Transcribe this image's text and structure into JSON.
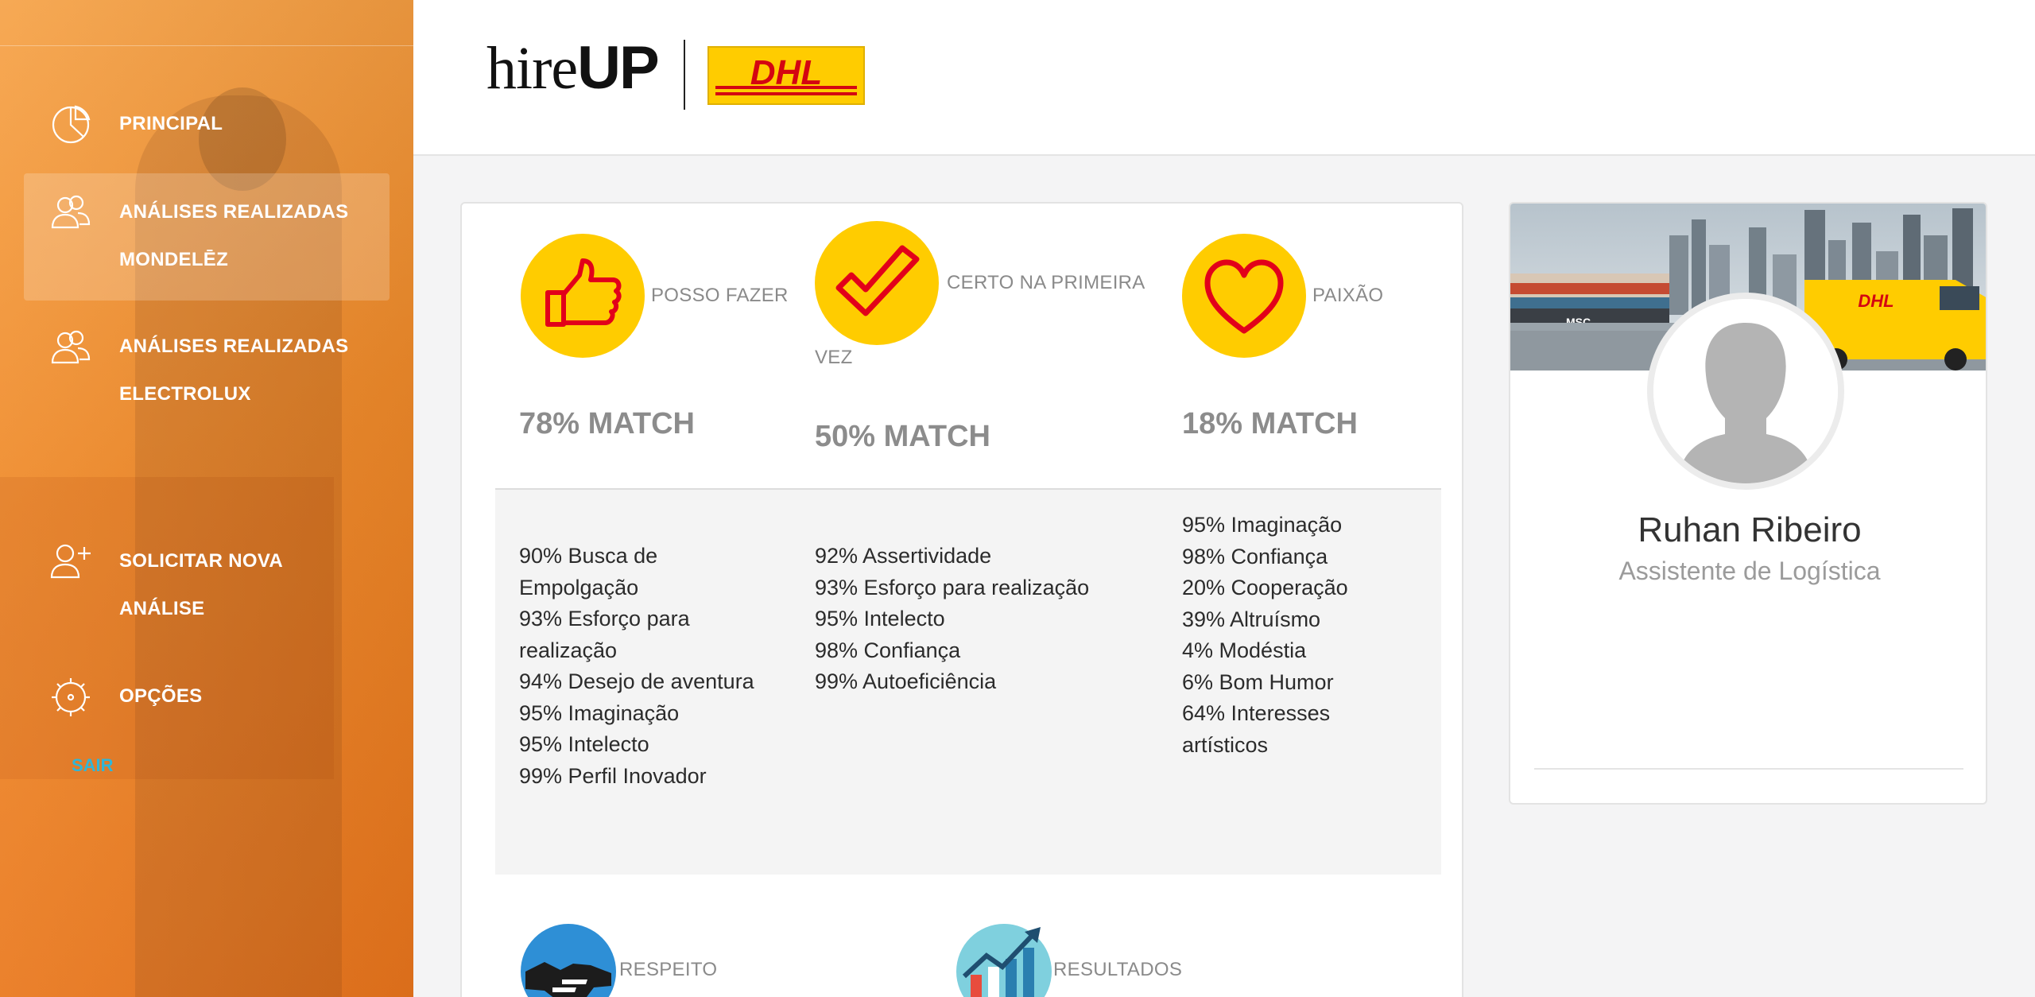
{
  "brand": {
    "logo_hire": "hire",
    "logo_up": "UP",
    "partner": "DHL"
  },
  "sidebar": {
    "items": [
      {
        "icon": "pie-chart-icon",
        "lines": [
          "PRINCIPAL"
        ]
      },
      {
        "icon": "users-icon",
        "lines": [
          "ANÁLISES REALIZADAS",
          "MONDELĒZ"
        ],
        "active": true
      },
      {
        "icon": "users-icon",
        "lines": [
          "ANÁLISES REALIZADAS",
          "ELECTROLUX"
        ]
      },
      {
        "icon": "add-user-icon",
        "lines": [
          "SOLICITAR NOVA",
          "ANÁLISE"
        ]
      },
      {
        "icon": "gear-icon",
        "lines": [
          "OPÇÕES"
        ]
      }
    ],
    "logout": "SAIR",
    "accent": "#ef8a2a",
    "logout_color": "#2fb6d8"
  },
  "traits": [
    {
      "icon": "thumbs-up-icon",
      "label": "POSSO FAZER",
      "match": "78% MATCH",
      "details": [
        "90% Busca de",
        "Empolgação",
        "93% Esforço para",
        "realização",
        "94% Desejo de aventura",
        "95% Imaginação",
        "95% Intelecto",
        "99% Perfil Inovador"
      ]
    },
    {
      "icon": "checkmark-icon",
      "label_line1": "CERTO NA PRIMEIRA",
      "label_line2": "VEZ",
      "match": "50% MATCH",
      "details": [
        "92% Assertividade",
        "93% Esforço para realização",
        "95% Intelecto",
        "98% Confiança",
        "99% Autoeficiência"
      ]
    },
    {
      "icon": "heart-icon",
      "label": "PAIXÃO",
      "match": "18% MATCH",
      "details": [
        "95% Imaginação",
        "98% Confiança",
        "20% Cooperação",
        "39% Altruísmo",
        "4% Modéstia",
        "6% Bom Humor",
        "64% Interesses",
        "artísticos"
      ]
    }
  ],
  "bottom_traits": [
    {
      "icon": "handshake-icon",
      "label": "RESPEITO"
    },
    {
      "icon": "growth-chart-icon",
      "label": "RESULTADOS"
    }
  ],
  "profile": {
    "name": "Ruhan Ribeiro",
    "role": "Assistente de Logística",
    "banner_logo": "DHL",
    "ship_text": "MSC"
  },
  "colors": {
    "badge_yellow": "#ffcc00",
    "badge_red": "#e2001a",
    "dhl_red": "#d40511"
  }
}
